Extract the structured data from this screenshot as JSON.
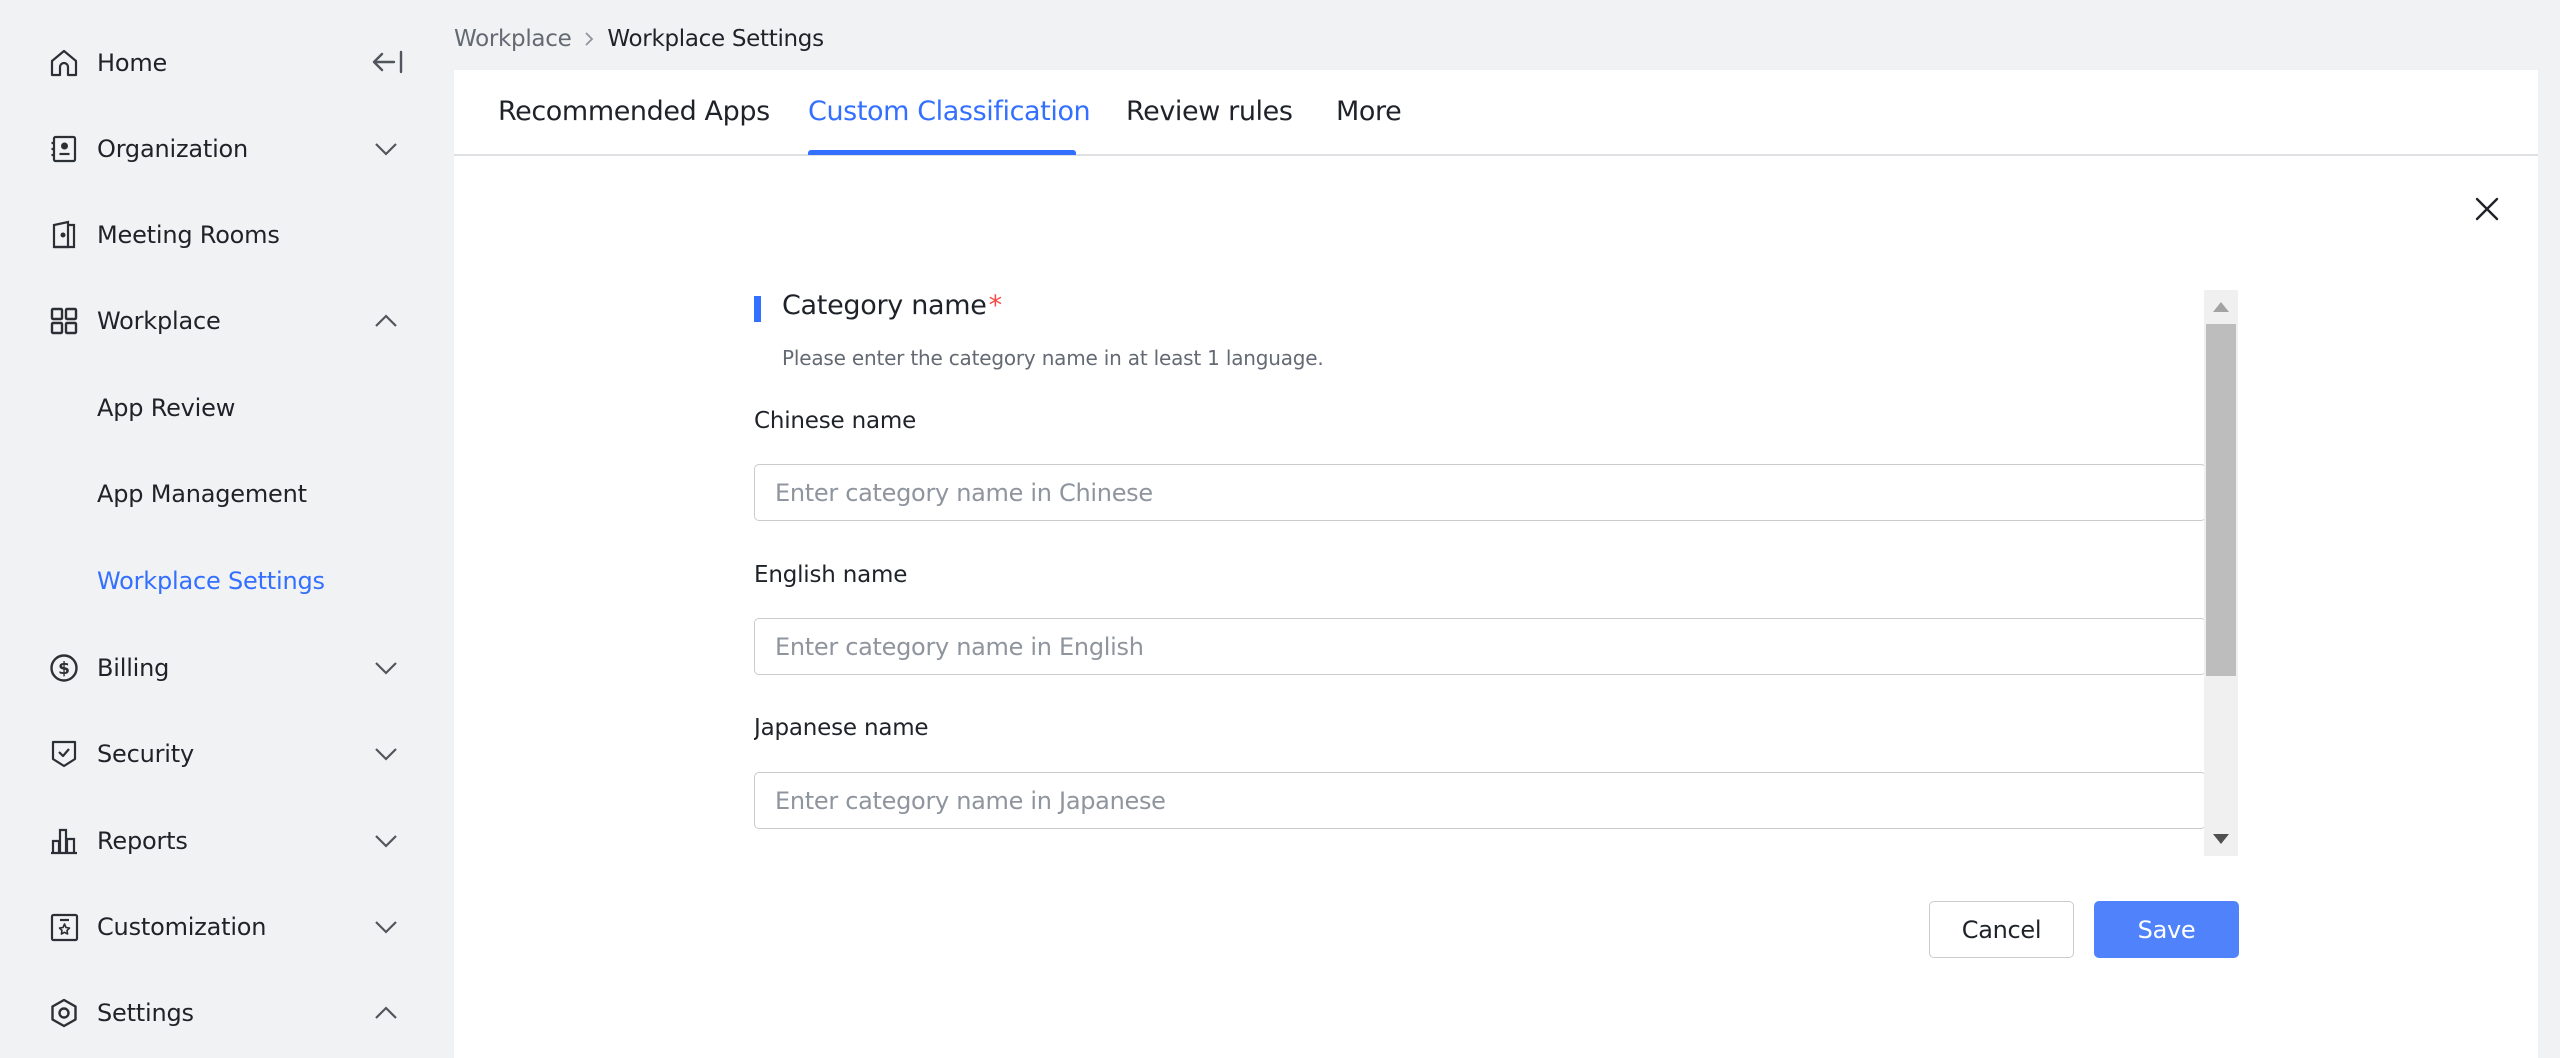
{
  "sidebar": {
    "collapse_icon": "collapse-left-icon",
    "items": [
      {
        "label": "Home",
        "icon": "home-icon",
        "chevron": null
      },
      {
        "label": "Organization",
        "icon": "contacts-book-icon",
        "chevron": "down"
      },
      {
        "label": "Meeting Rooms",
        "icon": "door-icon",
        "chevron": null
      },
      {
        "label": "Workplace",
        "icon": "grid-icon",
        "chevron": "up"
      },
      {
        "label": "App Review",
        "icon": null,
        "chevron": null
      },
      {
        "label": "App Management",
        "icon": null,
        "chevron": null
      },
      {
        "label": "Workplace Settings",
        "icon": null,
        "chevron": null,
        "active": true
      },
      {
        "label": "Billing",
        "icon": "dollar-circle-icon",
        "chevron": "down"
      },
      {
        "label": "Security",
        "icon": "shield-check-icon",
        "chevron": "down"
      },
      {
        "label": "Reports",
        "icon": "bar-chart-icon",
        "chevron": "down"
      },
      {
        "label": "Customization",
        "icon": "badge-star-icon",
        "chevron": "down"
      },
      {
        "label": "Settings",
        "icon": "hexagon-gear-icon",
        "chevron": "up"
      }
    ]
  },
  "breadcrumb": {
    "parent": "Workplace",
    "current": "Workplace Settings"
  },
  "tabs": [
    {
      "label": "Recommended Apps",
      "active": false
    },
    {
      "label": "Custom Classification",
      "active": true
    },
    {
      "label": "Review rules",
      "active": false
    },
    {
      "label": "More",
      "active": false
    }
  ],
  "colors": {
    "accent": "#3370ff",
    "save_button": "#5083fb",
    "required": "#f54a45",
    "background": "#f1f2f4"
  },
  "form": {
    "section_title": "Category name",
    "required_mark": "*",
    "hint": "Please enter the category name in at least 1 language.",
    "fields": [
      {
        "label": "Chinese name",
        "value": "",
        "placeholder": "Enter category name in Chinese"
      },
      {
        "label": "English name",
        "value": "",
        "placeholder": "Enter category name in English"
      },
      {
        "label": "Japanese name",
        "value": "",
        "placeholder": "Enter category name in Japanese"
      }
    ],
    "scroll_position": 0
  },
  "actions": {
    "cancel_label": "Cancel",
    "save_label": "Save"
  }
}
